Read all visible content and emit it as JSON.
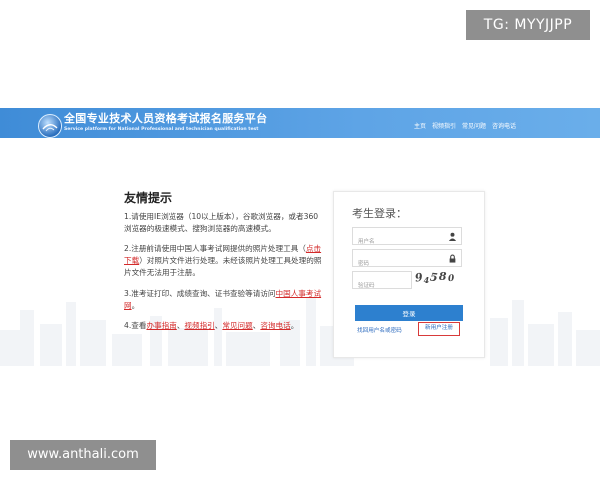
{
  "watermark_top": "TG: MYYJJPP",
  "watermark_bottom": "www.anthali.com",
  "header": {
    "title": "全国专业技术人员资格考试报名服务平台",
    "subtitle": "Service platform for National Professional and technician qualification test",
    "nav": [
      "主页",
      "视频指引",
      "常见问题",
      "咨询电话"
    ],
    "color": "#4a97dd"
  },
  "tips": {
    "title": "友情提示",
    "t1": "1.请使用IE浏览器（10以上版本），谷歌浏览器，或者360浏览器的极速模式、搜狗浏览器的高速模式。",
    "t2_a": "2.注册前请使用中国人事考试网提供的照片处理工具（",
    "t2_link": "点击下载",
    "t2_b": "）对照片文件进行处理。未经该照片处理工具处理的照片文件无法用于注册。",
    "t3_a": "3.准考证打印、成绩查询、证书查验等请访问",
    "t3_link": "中国人事考试网",
    "t3_b": "。",
    "t4_a": "4.查看",
    "t4_l1": "办事指南",
    "t4_sep1": "、",
    "t4_l2": "视频指引",
    "t4_sep2": "、",
    "t4_l3": "常见问题",
    "t4_sep3": "、",
    "t4_l4": "咨询电话",
    "t4_b": "。"
  },
  "login": {
    "title": "考生登录：",
    "username_placeholder": "用户名",
    "password_placeholder": "密码",
    "captcha_placeholder": "验证码",
    "captcha_text": [
      "9",
      "4",
      "5",
      "8",
      "0"
    ],
    "button": "登录",
    "forgot": "找回用户名或密码",
    "register": "新用户注册",
    "button_color": "#2d80cf"
  }
}
